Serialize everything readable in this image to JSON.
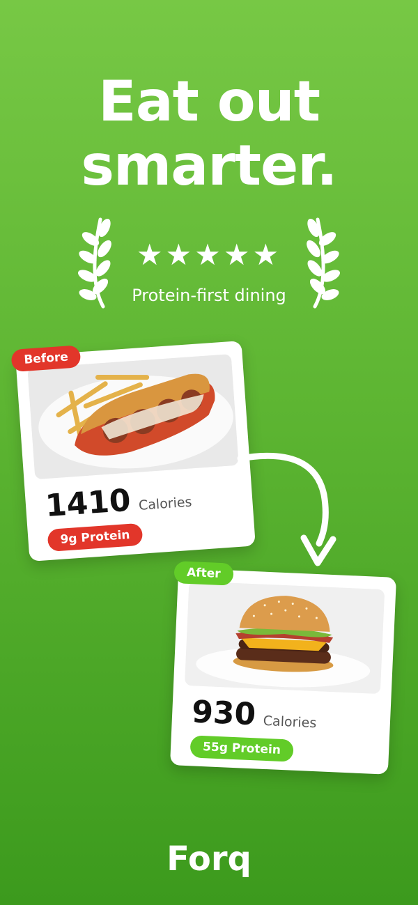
{
  "headline": {
    "line1": "Eat out",
    "line2": "smarter."
  },
  "rating": {
    "stars": "★★★★★",
    "caption": "Protein-first dining"
  },
  "before": {
    "tag": "Before",
    "calories": "1410",
    "unit": "Calories",
    "protein": "9g Protein"
  },
  "after": {
    "tag": "After",
    "calories": "930",
    "unit": "Calories",
    "protein": "55g Protein"
  },
  "brand": "Forq",
  "colors": {
    "accent_red": "#e2362a",
    "accent_green": "#62cc28",
    "background": "#5db532"
  }
}
